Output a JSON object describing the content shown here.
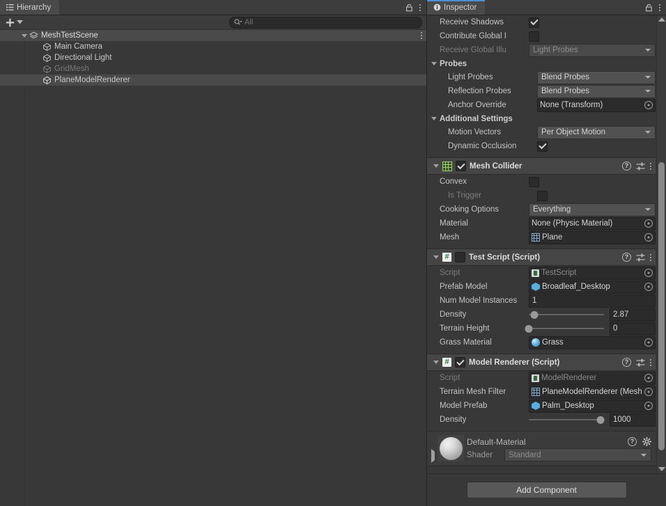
{
  "hierarchy": {
    "tab_label": "Hierarchy",
    "tab_icon": "hierarchy-icon",
    "lock_icon": "lock-icon",
    "menu_icon": "kebab-menu-icon",
    "create_label": "+",
    "search": {
      "value": "",
      "placeholder": "All",
      "icon": "search-icon"
    },
    "scene": {
      "name": "MeshTestScene",
      "icon": "scene-icon",
      "expanded": true
    },
    "objects": [
      {
        "name": "Main Camera",
        "icon": "gameobject-cube-icon",
        "dim": false,
        "selected": false
      },
      {
        "name": "Directional Light",
        "icon": "gameobject-cube-icon",
        "dim": false,
        "selected": false
      },
      {
        "name": "GridMesh",
        "icon": "gameobject-cube-icon",
        "dim": true,
        "selected": false
      },
      {
        "name": "PlaneModelRenderer",
        "icon": "gameobject-cube-icon",
        "dim": false,
        "selected": true
      }
    ]
  },
  "inspector": {
    "tab_label": "Inspector",
    "tab_icon": "info-icon",
    "lock_icon": "lock-icon",
    "menu_icon": "kebab-menu-icon",
    "accent_color": "#4a90d9",
    "renderer_partial": {
      "receive_shadows": {
        "label": "Receive Shadows",
        "checked": true
      },
      "contribute_gi": {
        "label": "Contribute Global I",
        "checked": false
      },
      "receive_gi": {
        "label": "Receive Global Illu",
        "value": "Light Probes",
        "disabled": true
      }
    },
    "probes_section": {
      "title": "Probes",
      "expanded": true,
      "light_probes": {
        "label": "Light Probes",
        "value": "Blend Probes"
      },
      "reflection_probes": {
        "label": "Reflection Probes",
        "value": "Blend Probes"
      },
      "anchor_override": {
        "label": "Anchor Override",
        "value": "None (Transform)"
      }
    },
    "additional_section": {
      "title": "Additional Settings",
      "expanded": true,
      "motion_vectors": {
        "label": "Motion Vectors",
        "value": "Per Object Motion"
      },
      "dynamic_occlusion": {
        "label": "Dynamic Occlusion",
        "checked": true
      }
    },
    "mesh_collider": {
      "title": "Mesh Collider",
      "icon": "mesh-collider-grid-icon",
      "enabled": true,
      "expanded": true,
      "help_icon": "help-icon",
      "preset_icon": "preset-icon",
      "menu_icon": "kebab-menu-icon",
      "convex": {
        "label": "Convex",
        "checked": false
      },
      "is_trigger": {
        "label": "Is Trigger",
        "checked": false,
        "disabled": true
      },
      "cooking_options": {
        "label": "Cooking Options",
        "value": "Everything"
      },
      "material": {
        "label": "Material",
        "value": "None (Physic Material)"
      },
      "mesh": {
        "label": "Mesh",
        "value": "Plane",
        "icon": "mesh-icon"
      }
    },
    "test_script": {
      "title": "Test Script (Script)",
      "icon": "cs-script-icon",
      "enabled": false,
      "expanded": true,
      "help_icon": "help-icon",
      "preset_icon": "preset-icon",
      "menu_icon": "kebab-menu-icon",
      "script": {
        "label": "Script",
        "value": "TestScript",
        "disabled": true,
        "icon": "script-asset-icon"
      },
      "prefab_model": {
        "label": "Prefab Model",
        "value": "Broadleaf_Desktop",
        "icon": "prefab-icon"
      },
      "num_model_instances": {
        "label": "Num Model Instances",
        "value": "1"
      },
      "density": {
        "label": "Density",
        "value": "2.87",
        "slider_percent": 7
      },
      "terrain_height": {
        "label": "Terrain Height",
        "value": "0",
        "slider_percent": 0
      },
      "grass_material": {
        "label": "Grass Material",
        "value": "Grass",
        "icon": "material-icon"
      }
    },
    "model_renderer": {
      "title": "Model Renderer (Script)",
      "icon": "cs-script-icon",
      "enabled": true,
      "expanded": true,
      "help_icon": "help-icon",
      "preset_icon": "preset-icon",
      "menu_icon": "kebab-menu-icon",
      "script": {
        "label": "Script",
        "value": "ModelRenderer",
        "disabled": true,
        "icon": "script-asset-icon"
      },
      "terrain_mesh_filter": {
        "label": "Terrain Mesh Filter",
        "value": "PlaneModelRenderer (Mesh",
        "icon": "mesh-icon"
      },
      "model_prefab": {
        "label": "Model Prefab",
        "value": "Palm_Desktop",
        "icon": "prefab-icon"
      },
      "density": {
        "label": "Density",
        "value": "1000",
        "slider_percent": 95
      }
    },
    "material_block": {
      "name": "Default-Material",
      "expanded": false,
      "preview_icon": "material-sphere-preview",
      "help_icon": "help-icon",
      "settings_icon": "gear-icon",
      "shader": {
        "label": "Shader",
        "value": "Standard"
      }
    },
    "add_component_label": "Add Component",
    "scrollbar": {
      "thumb_top_percent": 32,
      "thumb_height_percent": 63
    }
  }
}
